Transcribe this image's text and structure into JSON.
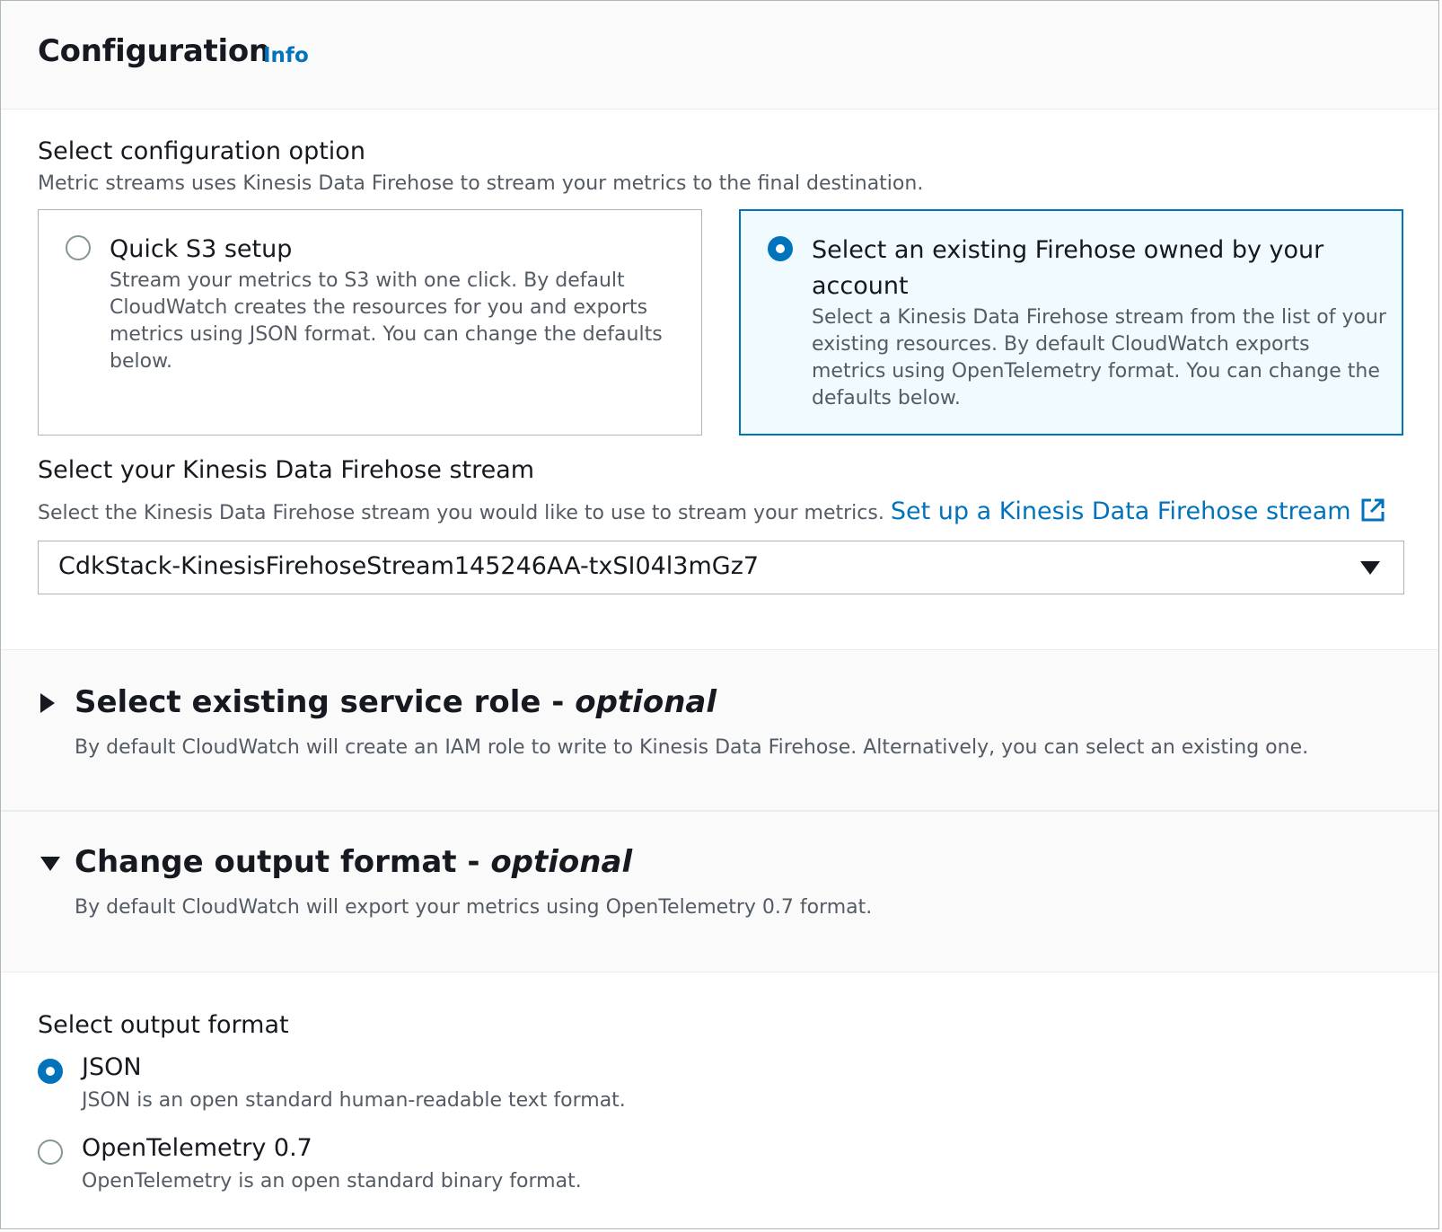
{
  "header": {
    "title": "Configuration",
    "info_label": "Info"
  },
  "config_option": {
    "label": "Select configuration option",
    "description": "Metric streams uses Kinesis Data Firehose to stream your metrics to the final destination.",
    "tiles": [
      {
        "title": "Quick S3 setup",
        "description": "Stream your metrics to S3 with one click. By default CloudWatch creates the resources for you and exports metrics using JSON format. You can change the defaults below.",
        "selected": false
      },
      {
        "title": "Select an existing Firehose owned by your account",
        "description": "Select a Kinesis Data Firehose stream from the list of your existing resources. By default CloudWatch exports metrics using OpenTelemetry format. You can change the defaults below.",
        "selected": true
      }
    ]
  },
  "stream": {
    "label": "Select your Kinesis Data Firehose stream",
    "description": "Select the Kinesis Data Firehose stream you would like to use to stream your metrics.",
    "setup_link": "Set up a Kinesis Data Firehose stream",
    "setup_link_icon": "external-link-icon",
    "selected_value": "CdkStack-KinesisFirehoseStream145246AA-txSI04l3mGz7"
  },
  "service_role": {
    "title": "Select existing service role - ",
    "title_optional": "optional",
    "description": "By default CloudWatch will create an IAM role to write to Kinesis Data Firehose. Alternatively, you can select an existing one.",
    "expanded": false
  },
  "output_format": {
    "title": "Change output format - ",
    "title_optional": "optional",
    "description": "By default CloudWatch will export your metrics using OpenTelemetry 0.7 format.",
    "expanded": true,
    "select_label": "Select output format",
    "options": [
      {
        "label": "JSON",
        "description": "JSON is an open standard human-readable text format.",
        "selected": true
      },
      {
        "label": "OpenTelemetry 0.7",
        "description": "OpenTelemetry is an open standard binary format.",
        "selected": false
      }
    ]
  },
  "colors": {
    "accent": "#0073bb",
    "text": "#16191f",
    "secondary_text": "#545b64",
    "border": "#aab7b8",
    "selected_tile_bg": "#f1faff"
  }
}
